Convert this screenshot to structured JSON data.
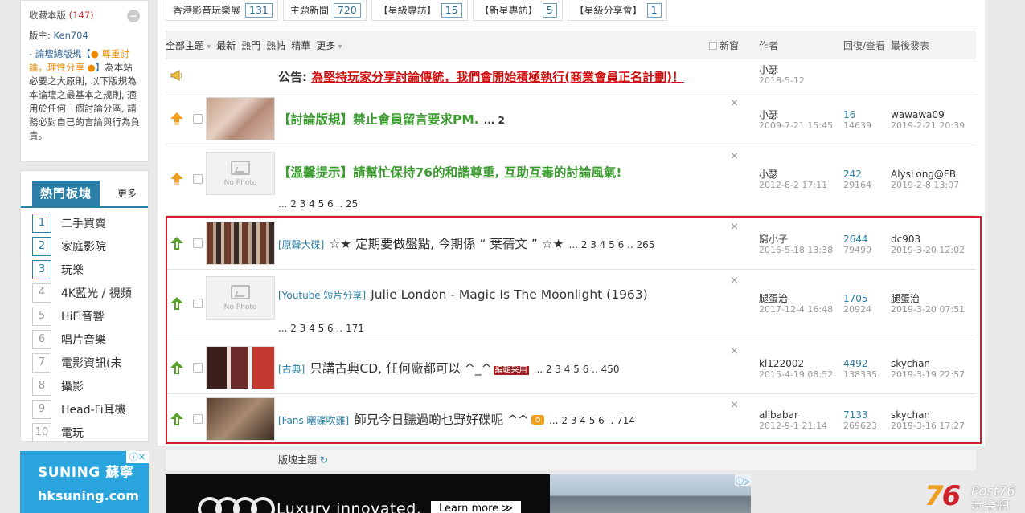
{
  "sidebar": {
    "favorites": {
      "label": "收藏本版",
      "count": "(147)",
      "moderator_label": "版主:",
      "moderator": "Ken704",
      "rule_prefix": "- ",
      "rule_link": "論壇總版規【",
      "rule_mid": "● 尊重討論，理性分享 ●",
      "rule_end": "】",
      "rule_text": "為本站必要之大原則, 以下版規為本論壇之最基本之規則, 適用於任何一個討論分區, 請務必對自已的言論與行為負責。"
    },
    "hot": {
      "title": "熱門板塊",
      "more": "更多",
      "items": [
        {
          "n": "1",
          "label": "二手買賣"
        },
        {
          "n": "2",
          "label": "家庭影院"
        },
        {
          "n": "3",
          "label": "玩樂"
        },
        {
          "n": "4",
          "label": "4K藍光 / 視頻"
        },
        {
          "n": "5",
          "label": "HiFi音響"
        },
        {
          "n": "6",
          "label": "唱片音樂"
        },
        {
          "n": "7",
          "label": "電影資訊(未"
        },
        {
          "n": "8",
          "label": "攝影"
        },
        {
          "n": "9",
          "label": "Head-Fi耳機"
        },
        {
          "n": "10",
          "label": "電玩"
        }
      ]
    },
    "ad": {
      "line1": "SUNING 蘇寧",
      "line2": "hksuning.com",
      "close": "ⓘ✕"
    }
  },
  "tabs": [
    {
      "label": "香港影音玩樂展",
      "count": "131"
    },
    {
      "label": "主題新聞",
      "count": "720"
    },
    {
      "label": "【星級專訪】",
      "count": "15"
    },
    {
      "label": "【新星專訪】",
      "count": "5"
    },
    {
      "label": "【星級分享會】",
      "count": "1"
    }
  ],
  "filter_bar": {
    "all": "全部主題",
    "newest": "最新",
    "hot": "熱門",
    "heat": "熱帖",
    "digest": "精華",
    "more": "更多",
    "new_window": "新窗",
    "col_author": "作者",
    "col_stats": "回復/查看",
    "col_last": "最後發表"
  },
  "announcement": {
    "prefix": "公告:",
    "text": "為堅持玩家分享討論傳統，我們會開始積極執行(商業會員正名計劃)！",
    "author": "小瑟",
    "date": "2018-5-12"
  },
  "threads": [
    {
      "title": "【討論版規】禁止會員留言要求PM.",
      "pages": "... 2",
      "author": "小瑟",
      "date": "2009-7-21 15:45",
      "replies": "16",
      "views": "14639",
      "last_user": "wawawa09",
      "last_date": "2019-2-21 20:39",
      "close": "×"
    },
    {
      "title": "【溫馨提示】請幫忙保持76的和諧尊重, 互助互毒的討論風氣!",
      "pages": "... 2 3 4 5 6 .. 25",
      "author": "小瑟",
      "date": "2012-8-2 17:11",
      "replies": "242",
      "views": "29164",
      "last_user": "AlysLong@FB",
      "last_date": "2019-2-8 13:07",
      "nophoto": "No Photo",
      "close": "×"
    },
    {
      "cat": "[原聲大碟]",
      "title": "☆★ 定期要做盤點, 今期係 “ 葉蒨文 ” ☆★",
      "pages": "... 2 3 4 5 6 .. 265",
      "author": "窮小子",
      "date": "2016-5-18 13:38",
      "replies": "2644",
      "views": "79490",
      "last_user": "dc903",
      "last_date": "2019-3-20 12:02",
      "close": "×"
    },
    {
      "cat": "[Youtube 短片分享]",
      "title": "Julie London - Magic Is The Moonlight (1963)",
      "pages": "... 2 3 4 5 6 .. 171",
      "author": "腿蛋治",
      "date": "2017-12-4 16:48",
      "replies": "1705",
      "views": "20924",
      "last_user": "腿蛋治",
      "last_date": "2019-3-20 07:51",
      "nophoto": "No Photo",
      "close": "×"
    },
    {
      "cat": "[古典]",
      "title": "只講古典CD, 任何廠都可以 ^_^",
      "badge": "編輯采用",
      "pages": "... 2 3 4 5 6 .. 450",
      "author": "kl122002",
      "date": "2015-4-19 08:52",
      "replies": "4492",
      "views": "138335",
      "last_user": "skychan",
      "last_date": "2019-3-19 22:57",
      "close": "×"
    },
    {
      "cat": "[Fans 曬碟吹雞]",
      "title": "師兄今日聽過啲乜野好碟呢 ^^",
      "pages": "... 2 3 4 5 6 .. 714",
      "author": "alibabar",
      "date": "2012-9-1 21:14",
      "replies": "7133",
      "views": "269623",
      "last_user": "skychan",
      "last_date": "2019-3-16 17:27",
      "close": "×"
    }
  ],
  "footer": {
    "label": "版塊主題",
    "refresh": "↻"
  },
  "bottom_ad": {
    "text": "Luxury innovated.",
    "cta": "Learn more ≫",
    "info": "ⓘ▷"
  },
  "logo": {
    "num1": "7",
    "num2": "6",
    "post": "Post76",
    "zh": "玩樂網"
  },
  "colors": {
    "accent": "#2b7fa6",
    "highlight_border": "#d0202a",
    "sticky_title": "#3a9b2e",
    "announcement_link": "#d01010"
  }
}
